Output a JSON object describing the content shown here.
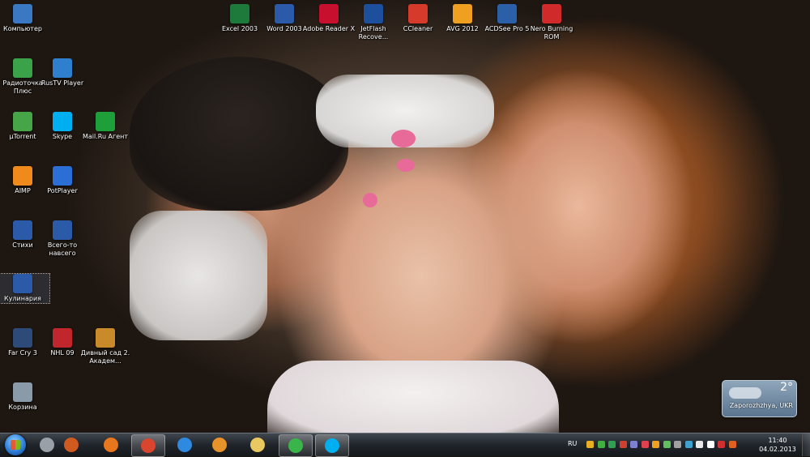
{
  "desktop_icons": [
    {
      "label": "Компьютер",
      "icon": "computer-icon",
      "color": "#3b78c4"
    },
    {
      "label": "Радиоточка Плюс",
      "icon": "radio-icon",
      "color": "#3aa34a"
    },
    {
      "label": "RusTV Player",
      "icon": "tv-player-icon",
      "color": "#2f7fcf"
    },
    {
      "label": "µTorrent",
      "icon": "utorrent-icon",
      "color": "#46a546"
    },
    {
      "label": "Skype",
      "icon": "skype-icon",
      "color": "#00aff0"
    },
    {
      "label": "Mail.Ru Агент",
      "icon": "mailru-agent-icon",
      "color": "#1f9f3a"
    },
    {
      "label": "AIMP",
      "icon": "aimp-icon",
      "color": "#f08a1c"
    },
    {
      "label": "PotPlayer",
      "icon": "potplayer-icon",
      "color": "#2b6fd6"
    },
    {
      "label": "Стихи",
      "icon": "word-document-icon",
      "color": "#2a5aa8"
    },
    {
      "label": "Всего-то навсего",
      "icon": "word-document-icon",
      "color": "#2a5aa8"
    },
    {
      "label": "Кулинария",
      "icon": "word-document-icon",
      "color": "#2a5aa8"
    },
    {
      "label": "Far Cry 3",
      "icon": "farcry3-icon",
      "color": "#2d4a78"
    },
    {
      "label": "NHL 09",
      "icon": "nhl09-icon",
      "color": "#c0262c"
    },
    {
      "label": "Дивный сад 2. Академ...",
      "icon": "game-icon",
      "color": "#c98a2a"
    },
    {
      "label": "Корзина",
      "icon": "recycle-bin-icon",
      "color": "#8a9aa8"
    },
    {
      "label": "Excel 2003",
      "icon": "excel-icon",
      "color": "#1e7a3a"
    },
    {
      "label": "Word 2003",
      "icon": "word-icon",
      "color": "#2a5aa8"
    },
    {
      "label": "Adobe Reader X",
      "icon": "adobe-reader-icon",
      "color": "#c8102e"
    },
    {
      "label": "JetFlash Recove...",
      "icon": "jetflash-icon",
      "color": "#1d4f9c"
    },
    {
      "label": "CCleaner",
      "icon": "ccleaner-icon",
      "color": "#d63a2a"
    },
    {
      "label": "AVG 2012",
      "icon": "avg-icon",
      "color": "#f0a020"
    },
    {
      "label": "ACDSee Pro 5",
      "icon": "acdsee-icon",
      "color": "#2b5fa8"
    },
    {
      "label": "Nero Burning ROM",
      "icon": "nero-icon",
      "color": "#d02a2a"
    }
  ],
  "weather": {
    "temp": "2°",
    "city": "Zaporozhzhya, UKR"
  },
  "taskbar": {
    "start_icon": "windows-start-icon",
    "pinned": [
      {
        "icon": "media-player-icon",
        "color": "#9aa0a8"
      },
      {
        "icon": "ring-app-icon",
        "color": "#d05a20"
      },
      {
        "icon": "firefox-icon",
        "color": "#e8761c"
      },
      {
        "icon": "chrome-icon",
        "color": "#d9452e"
      },
      {
        "icon": "internet-explorer-icon",
        "color": "#2e8ae0"
      },
      {
        "icon": "video-player-icon",
        "color": "#e8932a"
      },
      {
        "icon": "file-explorer-icon",
        "color": "#e8c860"
      },
      {
        "icon": "mailru-agent-icon",
        "color": "#3ab54a"
      },
      {
        "icon": "skype-icon",
        "color": "#00aff0"
      }
    ],
    "language": "RU",
    "tray_colors": [
      "#e8b020",
      "#40b040",
      "#30a050",
      "#d04030",
      "#8080d0",
      "#e04050",
      "#f0a020",
      "#60c060",
      "#a0a0a0",
      "#40a0d0",
      "#e8e8e8",
      "#ffffff",
      "#d03030",
      "#e06020"
    ],
    "clock_time": "11:40",
    "clock_date": "04.02.2013"
  }
}
